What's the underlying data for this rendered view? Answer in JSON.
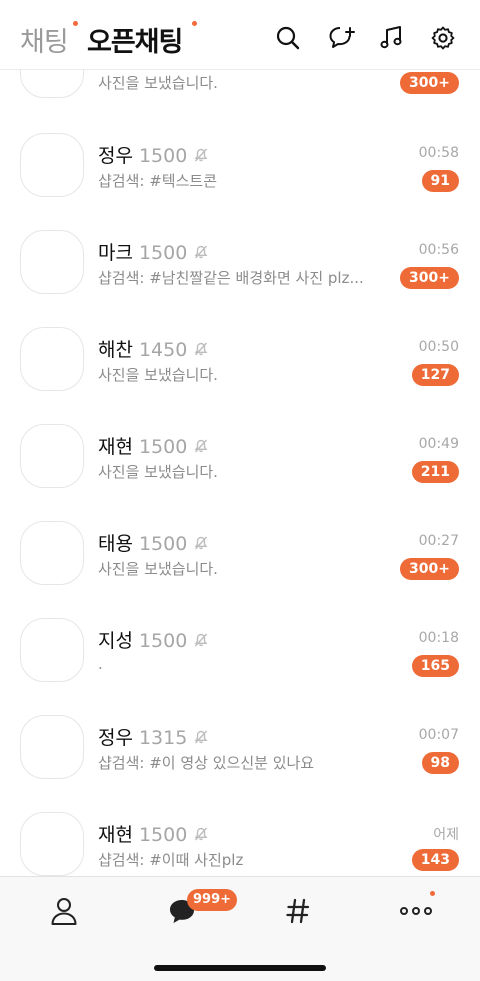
{
  "header": {
    "tabs": [
      {
        "label": "채팅",
        "active": false
      },
      {
        "label": "오픈채팅",
        "active": true
      }
    ],
    "icons": [
      "search-icon",
      "new-chat-icon",
      "music-icon",
      "settings-icon"
    ]
  },
  "chats": [
    {
      "title": "",
      "count": "",
      "message": "사진을 보냈습니다.",
      "time": "",
      "badge": "300+"
    },
    {
      "title": "정우",
      "count": "1500",
      "message": "샵검색: #텍스트콘",
      "time": "00:58",
      "badge": "91"
    },
    {
      "title": "마크",
      "count": "1500",
      "message": "샵검색: #남친짤같은 배경화면 사진 plz...",
      "time": "00:56",
      "badge": "300+"
    },
    {
      "title": "해찬",
      "count": "1450",
      "message": "사진을 보냈습니다.",
      "time": "00:50",
      "badge": "127"
    },
    {
      "title": "재현",
      "count": "1500",
      "message": "사진을 보냈습니다.",
      "time": "00:49",
      "badge": "211"
    },
    {
      "title": "태용",
      "count": "1500",
      "message": "사진을 보냈습니다.",
      "time": "00:27",
      "badge": "300+"
    },
    {
      "title": "지성",
      "count": "1500",
      "message": ".",
      "time": "00:18",
      "badge": "165"
    },
    {
      "title": "정우",
      "count": "1315",
      "message": "샵검색: #이 영상 있으신분 있나요",
      "time": "00:07",
      "badge": "98"
    },
    {
      "title": "재현",
      "count": "1500",
      "message": "샵검색: #이때 사진plz",
      "time": "어제",
      "badge": "143"
    }
  ],
  "bottom_nav": {
    "items": [
      "friends-icon",
      "chats-icon",
      "hashtag-icon",
      "more-icon"
    ],
    "chat_badge": "999+"
  },
  "colors": {
    "accent": "#ee6a36"
  }
}
